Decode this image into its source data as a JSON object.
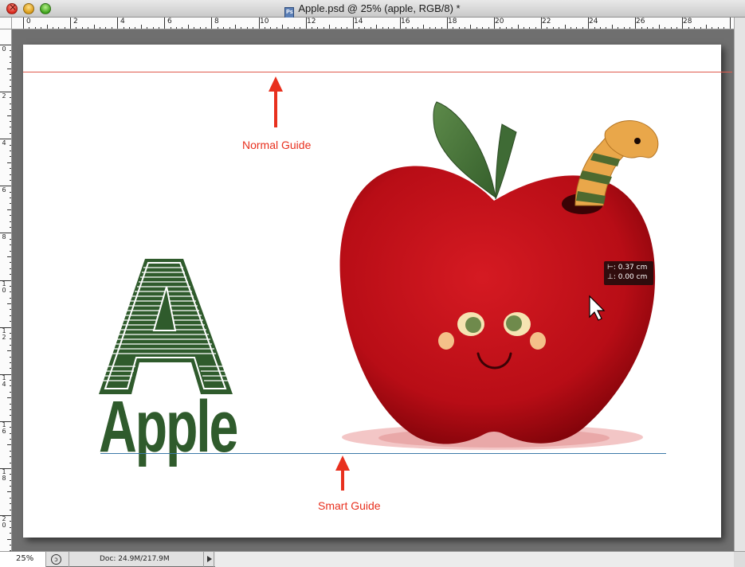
{
  "window": {
    "title": "Apple.psd @ 25% (apple, RGB/8) *",
    "doc_icon_label": "Ps"
  },
  "ruler": {
    "horizontal_labels": [
      "0",
      "2",
      "4",
      "6",
      "8",
      "10",
      "12",
      "14",
      "16",
      "18",
      "20",
      "22",
      "24",
      "26",
      "28"
    ],
    "vertical_labels": [
      "0",
      "2",
      "4",
      "6",
      "8",
      "10",
      "12",
      "14",
      "16",
      "18",
      "20"
    ]
  },
  "canvas": {
    "annotations": {
      "normal_guide": "Normal Guide",
      "smart_guide": "Smart Guide"
    },
    "measure_tooltip": {
      "horizontal": ": 0.37 cm",
      "vertical": ": 0.00 cm"
    },
    "logo": {
      "letter": "A",
      "word": "Apple"
    }
  },
  "status_bar": {
    "zoom": "25%",
    "doc_info": "Doc: 24.9M/217.9M"
  },
  "colors": {
    "normal_guide": "#e05a4d",
    "smart_guide": "#3d7aa8",
    "annotation_text": "#e8301e",
    "logo_green": "#2f5b2c",
    "apple_red": "#c0111b"
  }
}
